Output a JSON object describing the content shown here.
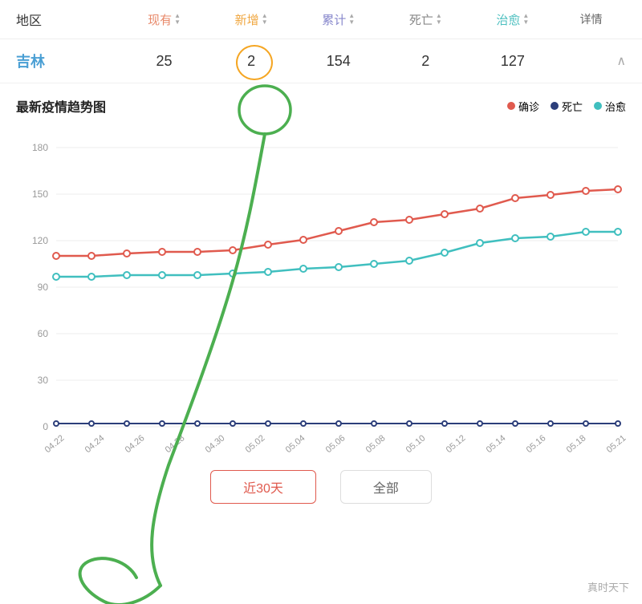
{
  "header": {
    "region_label": "地区",
    "xianyou_label": "现有",
    "xinzeng_label": "新增",
    "leiji_label": "累计",
    "siwang_label": "死亡",
    "zhiyu_label": "治愈",
    "xiangqing_label": "详情"
  },
  "data_row": {
    "region": "吉林",
    "xianyou": "25",
    "xinzeng": "2",
    "leiji": "154",
    "siwang": "2",
    "zhiyu": "127"
  },
  "chart": {
    "title": "最新疫情趋势图",
    "legend": {
      "confirmed": "确诊",
      "death": "死亡",
      "healed": "治愈"
    },
    "y_labels": [
      "180",
      "150",
      "120",
      "90",
      "60",
      "30",
      "0"
    ],
    "x_labels": [
      "04.22",
      "04.24",
      "04.26",
      "04.28",
      "04.30",
      "05.02",
      "05.04",
      "05.06",
      "05.08",
      "05.10",
      "05.12",
      "05.14",
      "05.16",
      "05.18",
      "05.21"
    ],
    "confirmed_data": [
      110,
      110,
      112,
      113,
      113,
      114,
      118,
      122,
      128,
      134,
      136,
      140,
      144,
      150,
      152,
      155,
      156
    ],
    "death_data": [
      2,
      2,
      2,
      2,
      2,
      2,
      2,
      2,
      2,
      2,
      2,
      2,
      2,
      2,
      2,
      2,
      2
    ],
    "healed_data": [
      97,
      97,
      98,
      98,
      98,
      99,
      100,
      102,
      103,
      105,
      107,
      112,
      118,
      122,
      123,
      126,
      126
    ]
  },
  "time_filter": {
    "recent_label": "近30天",
    "all_label": "全部"
  },
  "watermark": "真时天下"
}
